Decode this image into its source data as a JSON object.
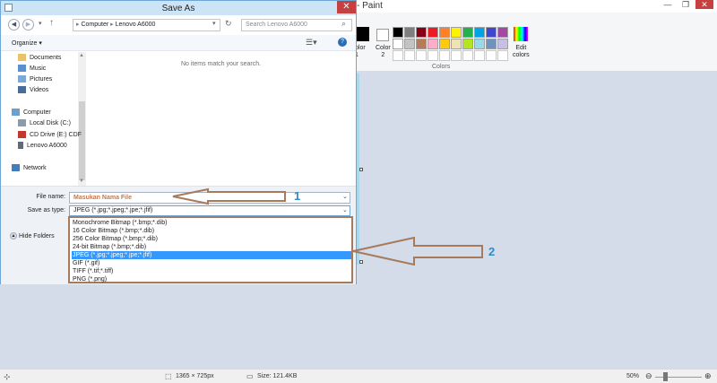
{
  "paint": {
    "title": "- Paint",
    "window_controls": [
      "—",
      "❐",
      "✕"
    ],
    "color1_label": "olor\n1",
    "color2_label": "Color\n2",
    "colors_group_label": "Colors",
    "edit_colors_label": "Edit\ncolors",
    "palette_row1": [
      "#000000",
      "#7f7f7f",
      "#880015",
      "#ed1c24",
      "#ff7f27",
      "#fff200",
      "#22b14c",
      "#00a2e8",
      "#3f48cc",
      "#a349a4"
    ],
    "palette_row2": [
      "#ffffff",
      "#c3c3c3",
      "#b97a57",
      "#ffaec9",
      "#ffc90e",
      "#efe4b0",
      "#b5e61d",
      "#99d9ea",
      "#7092be",
      "#c8bfe7"
    ],
    "status": {
      "dimensions": "1365 × 725px",
      "size": "Size: 121.4KB",
      "zoom": "50%",
      "zoom_level": 0.5
    }
  },
  "dialog": {
    "title": "Save As",
    "close": "✕",
    "breadcrumb": [
      "Computer",
      "Lenovo A6000"
    ],
    "search_placeholder": "Search Lenovo A6000",
    "toolbar": {
      "organize": "Organize ▾"
    },
    "nav_items": [
      {
        "label": "Documents",
        "icon": "documents-icon"
      },
      {
        "label": "Music",
        "icon": "music-icon"
      },
      {
        "label": "Pictures",
        "icon": "pictures-icon"
      },
      {
        "label": "Videos",
        "icon": "videos-icon"
      },
      {
        "label": "Computer",
        "icon": "computer-icon"
      },
      {
        "label": "Local Disk (C:)",
        "icon": "disk-icon"
      },
      {
        "label": "CD Drive (E:) CDF",
        "icon": "cd-drive-icon"
      },
      {
        "label": "Lenovo A6000",
        "icon": "phone-icon"
      },
      {
        "label": "Network",
        "icon": "network-icon"
      }
    ],
    "empty_message": "No items match your search.",
    "file_name_label": "File name:",
    "file_name_value": "Masukan Nama File",
    "save_type_label": "Save as type:",
    "save_type_value": "JPEG (*.jpg;*.jpeg;*.jpe;*.jfif)",
    "hide_folders": "Hide Folders",
    "file_types": [
      "Monochrome Bitmap (*.bmp;*.dib)",
      "16 Color Bitmap (*.bmp;*.dib)",
      "256 Color Bitmap (*.bmp;*.dib)",
      "24-bit Bitmap (*.bmp;*.dib)",
      "JPEG (*.jpg;*.jpeg;*.jpe;*.jfif)",
      "GIF (*.gif)",
      "TIFF (*.tif;*.tiff)",
      "PNG (*.png)"
    ],
    "selected_type_index": 4
  },
  "annotations": {
    "marker1": "1",
    "marker2": "2"
  },
  "colors": {
    "accent": "#3399ff",
    "annotation_arrow": "#a77a5c",
    "annotation_number": "#2c8cc8"
  }
}
